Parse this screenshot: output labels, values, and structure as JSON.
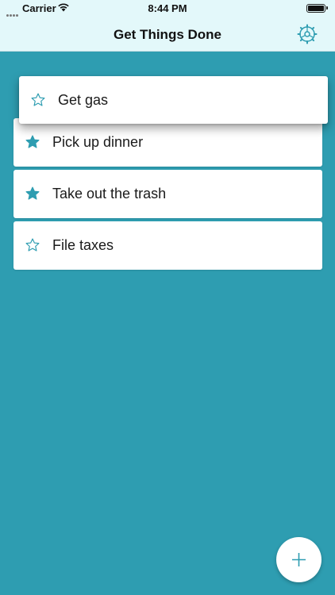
{
  "status_bar": {
    "carrier": "Carrier",
    "time": "8:44 PM"
  },
  "header": {
    "title": "Get Things Done",
    "settings_icon": "gear-icon"
  },
  "colors": {
    "background": "#2e9db1",
    "header": "#e3f8fa",
    "accent": "#2e9db1"
  },
  "dragging_item": {
    "label": "Get gas",
    "starred": false
  },
  "tasks": [
    {
      "label": "Pick up dinner",
      "starred": true
    },
    {
      "label": "Take out the trash",
      "starred": true
    },
    {
      "label": "File taxes",
      "starred": false
    }
  ],
  "fab": {
    "icon": "plus-icon"
  }
}
